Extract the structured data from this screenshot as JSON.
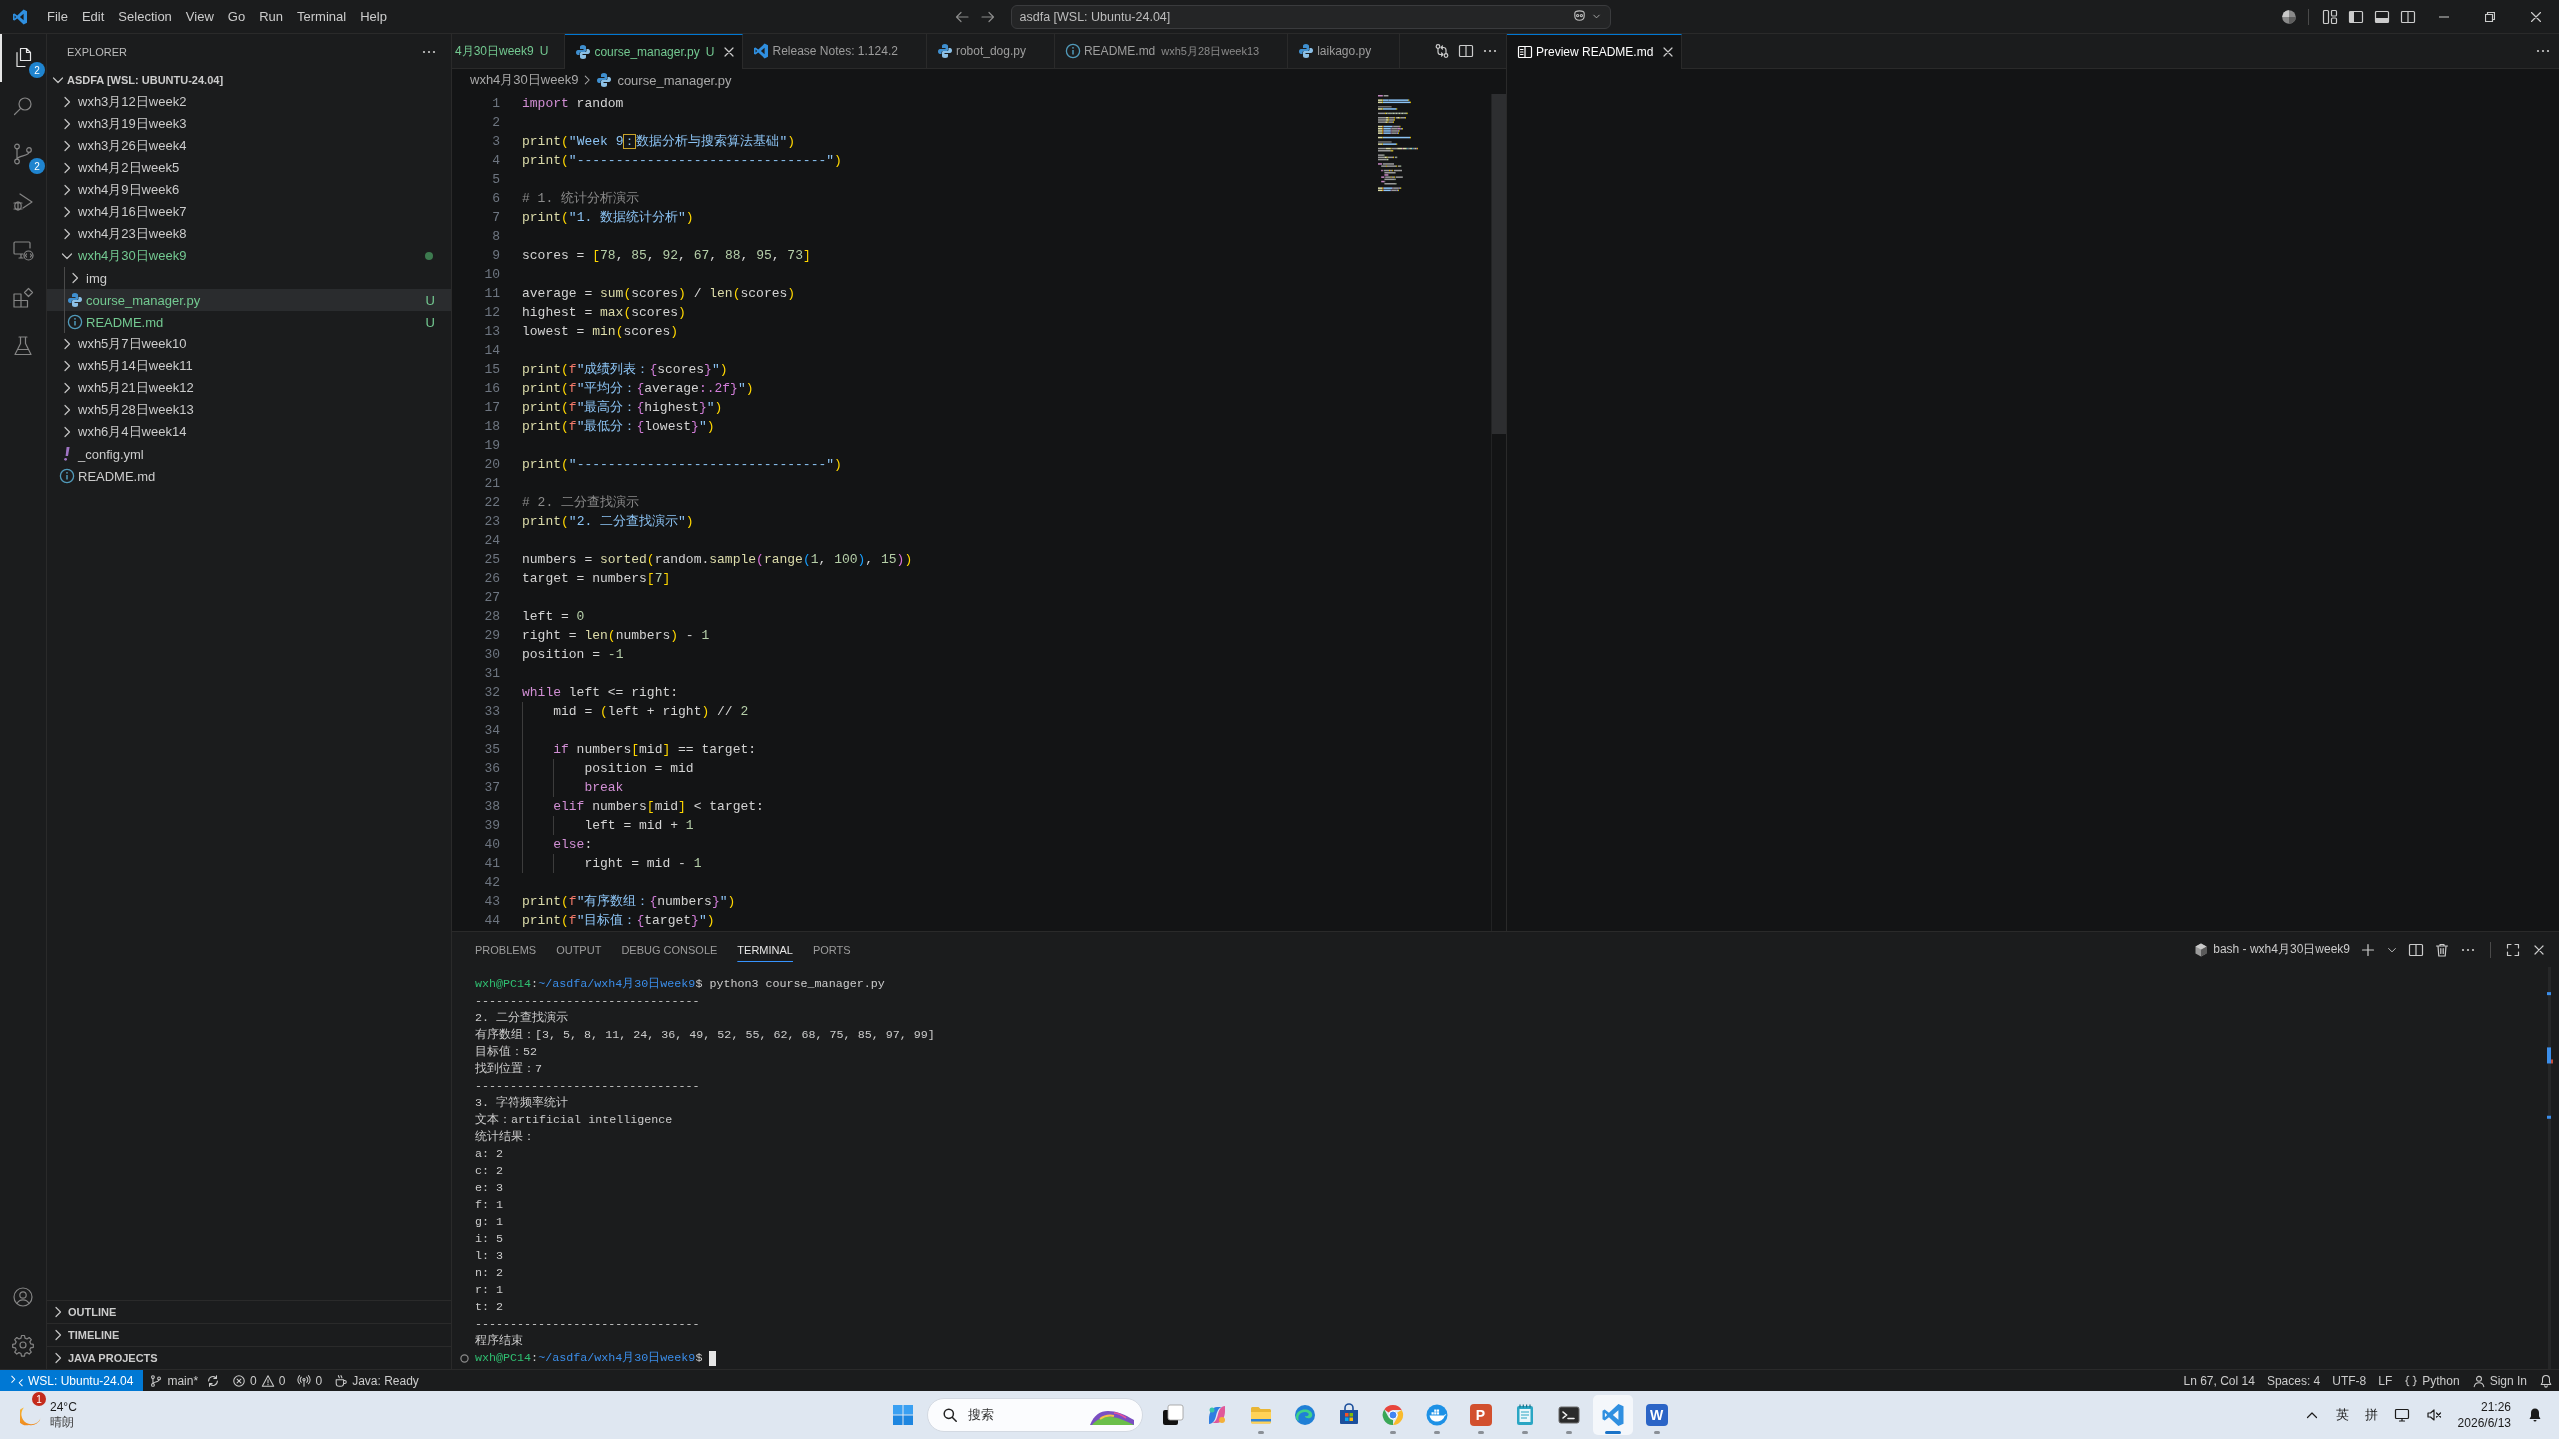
{
  "title_bar": {
    "menu": [
      "File",
      "Edit",
      "Selection",
      "View",
      "Go",
      "Run",
      "Terminal",
      "Help"
    ],
    "command_center": "asdfa [WSL: Ubuntu-24.04]"
  },
  "activity_bar": {
    "items": [
      {
        "kind": "explorer",
        "selected": true,
        "badge": "2"
      },
      {
        "kind": "search",
        "selected": false
      },
      {
        "kind": "source-control",
        "selected": false,
        "badge": "2"
      },
      {
        "kind": "run-debug",
        "selected": false
      },
      {
        "kind": "remote",
        "selected": false
      },
      {
        "kind": "extensions",
        "selected": false
      },
      {
        "kind": "testing",
        "selected": false
      }
    ]
  },
  "sidebar": {
    "title": "EXPLORER",
    "root": {
      "label": "ASDFA [WSL: UBUNTU-24.04]",
      "expanded": true
    },
    "tree": [
      {
        "name": "wxh3月12日week2",
        "kind": "folder",
        "expanded": false,
        "selected": false,
        "untracked": false
      },
      {
        "name": "wxh3月19日week3",
        "kind": "folder",
        "expanded": false,
        "selected": false,
        "untracked": false
      },
      {
        "name": "wxh3月26日week4",
        "kind": "folder",
        "expanded": false,
        "selected": false,
        "untracked": false
      },
      {
        "name": "wxh4月2日week5",
        "kind": "folder",
        "expanded": false,
        "selected": false,
        "untracked": false
      },
      {
        "name": "wxh4月9日week6",
        "kind": "folder",
        "expanded": false,
        "selected": false,
        "untracked": false
      },
      {
        "name": "wxh4月16日week7",
        "kind": "folder",
        "expanded": false,
        "selected": false,
        "untracked": false
      },
      {
        "name": "wxh4月23日week8",
        "kind": "folder",
        "expanded": false,
        "selected": false,
        "untracked": false
      },
      {
        "name": "wxh4月30日week9",
        "kind": "folder",
        "expanded": true,
        "selected": false,
        "untracked": true,
        "children": [
          {
            "name": "img",
            "kind": "folder",
            "expanded": false,
            "selected": false,
            "untracked": false
          },
          {
            "name": "course_manager.py",
            "kind": "python",
            "selected": true,
            "untracked": true,
            "status": "U"
          },
          {
            "name": "README.md",
            "kind": "markdown",
            "selected": false,
            "untracked": true,
            "status": "U"
          }
        ]
      },
      {
        "name": "wxh5月7日week10",
        "kind": "folder",
        "expanded": false,
        "selected": false,
        "untracked": false
      },
      {
        "name": "wxh5月14日week11",
        "kind": "folder",
        "expanded": false,
        "selected": false,
        "untracked": false
      },
      {
        "name": "wxh5月21日week12",
        "kind": "folder",
        "expanded": false,
        "selected": false,
        "untracked": false
      },
      {
        "name": "wxh5月28日week13",
        "kind": "folder",
        "expanded": false,
        "selected": false,
        "untracked": false
      },
      {
        "name": "wxh6月4日week14",
        "kind": "folder",
        "expanded": false,
        "selected": false,
        "untracked": false
      },
      {
        "name": "_config.yml",
        "kind": "yaml",
        "selected": false,
        "untracked": false
      },
      {
        "name": "README.md",
        "kind": "markdown",
        "selected": false,
        "untracked": false
      }
    ],
    "sections": [
      {
        "title": "OUTLINE",
        "expanded": false
      },
      {
        "title": "TIMELINE",
        "expanded": false
      },
      {
        "title": "JAVA PROJECTS",
        "expanded": false
      }
    ]
  },
  "editor": {
    "tabs": [
      {
        "label": "4月30日week9",
        "status": "U",
        "selected": false
      },
      {
        "label": "course_manager.py",
        "kind": "python",
        "status": "U",
        "selected": true
      },
      {
        "label": "Release Notes: 1.124.2",
        "kind": "release-notes",
        "selected": false
      },
      {
        "label": "robot_dog.py",
        "kind": "python",
        "selected": false
      },
      {
        "label": "README.md",
        "description": "wxh5月28日week13",
        "kind": "markdown",
        "selected": false
      },
      {
        "label": "laikago.py",
        "kind": "python",
        "selected": false
      }
    ],
    "breadcrumb": [
      {
        "text": "wxh4月30日week9",
        "kind": "folder"
      },
      {
        "text": "course_manager.py",
        "kind": "python"
      }
    ],
    "lines": [
      {
        "number": "1",
        "tokens": [
          {
            "text": "import",
            "kind": "keyword"
          },
          {
            "text": " random",
            "kind": "plain"
          }
        ]
      },
      {
        "number": "2"
      },
      {
        "number": "3",
        "tokens": [
          {
            "text": "print",
            "kind": "function"
          },
          {
            "text": "(",
            "kind": "bracket1"
          },
          {
            "text": "\"Week 9",
            "kind": "string"
          },
          {
            "text": "：",
            "kind": "flagged"
          },
          {
            "text": "数据分析与搜索算法基础\"",
            "kind": "string"
          },
          {
            "text": ")",
            "kind": "bracket1"
          }
        ]
      },
      {
        "number": "4",
        "tokens": [
          {
            "text": "print",
            "kind": "function"
          },
          {
            "text": "(",
            "kind": "bracket1"
          },
          {
            "text": "\"--------------------------------\"",
            "kind": "string"
          },
          {
            "text": ")",
            "kind": "bracket1"
          }
        ]
      },
      {
        "number": "5"
      },
      {
        "number": "6",
        "tokens": [
          {
            "text": "# 1. 统计分析演示",
            "kind": "comment"
          }
        ]
      },
      {
        "number": "7",
        "tokens": [
          {
            "text": "print",
            "kind": "function"
          },
          {
            "text": "(",
            "kind": "bracket1"
          },
          {
            "text": "\"1. 数据统计分析\"",
            "kind": "string"
          },
          {
            "text": ")",
            "kind": "bracket1"
          }
        ]
      },
      {
        "number": "8"
      },
      {
        "number": "9",
        "tokens": [
          {
            "text": "scores = ",
            "kind": "plain"
          },
          {
            "text": "[",
            "kind": "bracket1"
          },
          {
            "text": "78",
            "kind": "number"
          },
          {
            "text": ", ",
            "kind": "plain"
          },
          {
            "text": "85",
            "kind": "number"
          },
          {
            "text": ", ",
            "kind": "plain"
          },
          {
            "text": "92",
            "kind": "number"
          },
          {
            "text": ", ",
            "kind": "plain"
          },
          {
            "text": "67",
            "kind": "number"
          },
          {
            "text": ", ",
            "kind": "plain"
          },
          {
            "text": "88",
            "kind": "number"
          },
          {
            "text": ", ",
            "kind": "plain"
          },
          {
            "text": "95",
            "kind": "number"
          },
          {
            "text": ", ",
            "kind": "plain"
          },
          {
            "text": "73",
            "kind": "number"
          },
          {
            "text": "]",
            "kind": "bracket1"
          }
        ]
      },
      {
        "number": "10"
      },
      {
        "number": "11",
        "tokens": [
          {
            "text": "average = ",
            "kind": "plain"
          },
          {
            "text": "sum",
            "kind": "function"
          },
          {
            "text": "(",
            "kind": "bracket1"
          },
          {
            "text": "scores",
            "kind": "plain"
          },
          {
            "text": ")",
            "kind": "bracket1"
          },
          {
            "text": " / ",
            "kind": "plain"
          },
          {
            "text": "len",
            "kind": "function"
          },
          {
            "text": "(",
            "kind": "bracket1"
          },
          {
            "text": "scores",
            "kind": "plain"
          },
          {
            "text": ")",
            "kind": "bracket1"
          }
        ]
      },
      {
        "number": "12",
        "tokens": [
          {
            "text": "highest = ",
            "kind": "plain"
          },
          {
            "text": "max",
            "kind": "function"
          },
          {
            "text": "(",
            "kind": "bracket1"
          },
          {
            "text": "scores",
            "kind": "plain"
          },
          {
            "text": ")",
            "kind": "bracket1"
          }
        ]
      },
      {
        "number": "13",
        "tokens": [
          {
            "text": "lowest = ",
            "kind": "plain"
          },
          {
            "text": "min",
            "kind": "function"
          },
          {
            "text": "(",
            "kind": "bracket1"
          },
          {
            "text": "scores",
            "kind": "plain"
          },
          {
            "text": ")",
            "kind": "bracket1"
          }
        ]
      },
      {
        "number": "14"
      },
      {
        "number": "15",
        "tokens": [
          {
            "text": "print",
            "kind": "function"
          },
          {
            "text": "(",
            "kind": "bracket1"
          },
          {
            "text": "f",
            "kind": "prefix"
          },
          {
            "text": "\"成绩列表：",
            "kind": "string"
          },
          {
            "text": "{",
            "kind": "interp"
          },
          {
            "text": "scores",
            "kind": "plain"
          },
          {
            "text": "}",
            "kind": "interp"
          },
          {
            "text": "\"",
            "kind": "string"
          },
          {
            "text": ")",
            "kind": "bracket1"
          }
        ]
      },
      {
        "number": "16",
        "tokens": [
          {
            "text": "print",
            "kind": "function"
          },
          {
            "text": "(",
            "kind": "bracket1"
          },
          {
            "text": "f",
            "kind": "prefix"
          },
          {
            "text": "\"平均分：",
            "kind": "string"
          },
          {
            "text": "{",
            "kind": "interp"
          },
          {
            "text": "average",
            "kind": "plain"
          },
          {
            "text": ":.2f",
            "kind": "format"
          },
          {
            "text": "}",
            "kind": "interp"
          },
          {
            "text": "\"",
            "kind": "string"
          },
          {
            "text": ")",
            "kind": "bracket1"
          }
        ]
      },
      {
        "number": "17",
        "tokens": [
          {
            "text": "print",
            "kind": "function"
          },
          {
            "text": "(",
            "kind": "bracket1"
          },
          {
            "text": "f",
            "kind": "prefix"
          },
          {
            "text": "\"最高分：",
            "kind": "string"
          },
          {
            "text": "{",
            "kind": "interp"
          },
          {
            "text": "highest",
            "kind": "plain"
          },
          {
            "text": "}",
            "kind": "interp"
          },
          {
            "text": "\"",
            "kind": "string"
          },
          {
            "text": ")",
            "kind": "bracket1"
          }
        ]
      },
      {
        "number": "18",
        "tokens": [
          {
            "text": "print",
            "kind": "function"
          },
          {
            "text": "(",
            "kind": "bracket1"
          },
          {
            "text": "f",
            "kind": "prefix"
          },
          {
            "text": "\"最低分：",
            "kind": "string"
          },
          {
            "text": "{",
            "kind": "interp"
          },
          {
            "text": "lowest",
            "kind": "plain"
          },
          {
            "text": "}",
            "kind": "interp"
          },
          {
            "text": "\"",
            "kind": "string"
          },
          {
            "text": ")",
            "kind": "bracket1"
          }
        ]
      },
      {
        "number": "19"
      },
      {
        "number": "20",
        "tokens": [
          {
            "text": "print",
            "kind": "function"
          },
          {
            "text": "(",
            "kind": "bracket1"
          },
          {
            "text": "\"--------------------------------\"",
            "kind": "string"
          },
          {
            "text": ")",
            "kind": "bracket1"
          }
        ]
      },
      {
        "number": "21"
      },
      {
        "number": "22",
        "tokens": [
          {
            "text": "# 2. 二分查找演示",
            "kind": "comment"
          }
        ]
      },
      {
        "number": "23",
        "tokens": [
          {
            "text": "print",
            "kind": "function"
          },
          {
            "text": "(",
            "kind": "bracket1"
          },
          {
            "text": "\"2. 二分查找演示\"",
            "kind": "string"
          },
          {
            "text": ")",
            "kind": "bracket1"
          }
        ]
      },
      {
        "number": "24"
      },
      {
        "number": "25",
        "tokens": [
          {
            "text": "numbers = ",
            "kind": "plain"
          },
          {
            "text": "sorted",
            "kind": "function"
          },
          {
            "text": "(",
            "kind": "bracket1"
          },
          {
            "text": "random.",
            "kind": "plain"
          },
          {
            "text": "sample",
            "kind": "function"
          },
          {
            "text": "(",
            "kind": "bracket2"
          },
          {
            "text": "range",
            "kind": "function"
          },
          {
            "text": "(",
            "kind": "bracket3"
          },
          {
            "text": "1",
            "kind": "number"
          },
          {
            "text": ", ",
            "kind": "plain"
          },
          {
            "text": "100",
            "kind": "number"
          },
          {
            "text": ")",
            "kind": "bracket3"
          },
          {
            "text": ", ",
            "kind": "plain"
          },
          {
            "text": "15",
            "kind": "number"
          },
          {
            "text": ")",
            "kind": "bracket2"
          },
          {
            "text": ")",
            "kind": "bracket1"
          }
        ]
      },
      {
        "number": "26",
        "tokens": [
          {
            "text": "target = numbers",
            "kind": "plain"
          },
          {
            "text": "[",
            "kind": "bracket1"
          },
          {
            "text": "7",
            "kind": "number"
          },
          {
            "text": "]",
            "kind": "bracket1"
          }
        ]
      },
      {
        "number": "27"
      },
      {
        "number": "28",
        "tokens": [
          {
            "text": "left = ",
            "kind": "plain"
          },
          {
            "text": "0",
            "kind": "number"
          }
        ]
      },
      {
        "number": "29",
        "tokens": [
          {
            "text": "right = ",
            "kind": "plain"
          },
          {
            "text": "len",
            "kind": "function"
          },
          {
            "text": "(",
            "kind": "bracket1"
          },
          {
            "text": "numbers",
            "kind": "plain"
          },
          {
            "text": ")",
            "kind": "bracket1"
          },
          {
            "text": " - ",
            "kind": "plain"
          },
          {
            "text": "1",
            "kind": "number"
          }
        ]
      },
      {
        "number": "30",
        "tokens": [
          {
            "text": "position = ",
            "kind": "plain"
          },
          {
            "text": "-1",
            "kind": "number"
          }
        ]
      },
      {
        "number": "31"
      },
      {
        "number": "32",
        "tokens": [
          {
            "text": "while",
            "kind": "keyword"
          },
          {
            "text": " left <= right:",
            "kind": "plain"
          }
        ]
      },
      {
        "number": "33",
        "tokens": [
          {
            "text": "    mid = ",
            "kind": "plain"
          },
          {
            "text": "(",
            "kind": "bracket1"
          },
          {
            "text": "left + right",
            "kind": "plain"
          },
          {
            "text": ")",
            "kind": "bracket1"
          },
          {
            "text": " // ",
            "kind": "plain"
          },
          {
            "text": "2",
            "kind": "number"
          }
        ]
      },
      {
        "number": "34"
      },
      {
        "number": "35",
        "tokens": [
          {
            "text": "    if",
            "kind": "keyword"
          },
          {
            "text": " numbers",
            "kind": "plain"
          },
          {
            "text": "[",
            "kind": "bracket1"
          },
          {
            "text": "mid",
            "kind": "plain"
          },
          {
            "text": "]",
            "kind": "bracket1"
          },
          {
            "text": " == target:",
            "kind": "plain"
          }
        ]
      },
      {
        "number": "36",
        "tokens": [
          {
            "text": "        position = mid",
            "kind": "plain"
          }
        ]
      },
      {
        "number": "37",
        "tokens": [
          {
            "text": "        break",
            "kind": "keyword"
          }
        ]
      },
      {
        "number": "38",
        "tokens": [
          {
            "text": "    elif",
            "kind": "keyword"
          },
          {
            "text": " numbers",
            "kind": "plain"
          },
          {
            "text": "[",
            "kind": "bracket1"
          },
          {
            "text": "mid",
            "kind": "plain"
          },
          {
            "text": "]",
            "kind": "bracket1"
          },
          {
            "text": " < target:",
            "kind": "plain"
          }
        ]
      },
      {
        "number": "39",
        "tokens": [
          {
            "text": "        left = mid + ",
            "kind": "plain"
          },
          {
            "text": "1",
            "kind": "number"
          }
        ]
      },
      {
        "number": "40",
        "tokens": [
          {
            "text": "    else",
            "kind": "keyword"
          },
          {
            "text": ":",
            "kind": "plain"
          }
        ]
      },
      {
        "number": "41",
        "tokens": [
          {
            "text": "        right = mid - ",
            "kind": "plain"
          },
          {
            "text": "1",
            "kind": "number"
          }
        ]
      },
      {
        "number": "42"
      },
      {
        "number": "43",
        "tokens": [
          {
            "text": "print",
            "kind": "function"
          },
          {
            "text": "(",
            "kind": "bracket1"
          },
          {
            "text": "f",
            "kind": "prefix"
          },
          {
            "text": "\"有序数组：",
            "kind": "string"
          },
          {
            "text": "{",
            "kind": "interp"
          },
          {
            "text": "numbers",
            "kind": "plain"
          },
          {
            "text": "}",
            "kind": "interp"
          },
          {
            "text": "\"",
            "kind": "string"
          },
          {
            "text": ")",
            "kind": "bracket1"
          }
        ]
      },
      {
        "number": "44",
        "tokens": [
          {
            "text": "print",
            "kind": "function"
          },
          {
            "text": "(",
            "kind": "bracket1"
          },
          {
            "text": "f",
            "kind": "prefix"
          },
          {
            "text": "\"目标值：",
            "kind": "string"
          },
          {
            "text": "{",
            "kind": "interp"
          },
          {
            "text": "target",
            "kind": "plain"
          },
          {
            "text": "}",
            "kind": "interp"
          },
          {
            "text": "\"",
            "kind": "string"
          },
          {
            "text": ")",
            "kind": "bracket1"
          }
        ]
      }
    ]
  },
  "preview": {
    "tabs": [
      {
        "label": "Preview README.md",
        "kind": "preview",
        "selected": true
      }
    ]
  },
  "panel": {
    "tabs": [
      {
        "label": "PROBLEMS",
        "selected": false
      },
      {
        "label": "OUTPUT",
        "selected": false
      },
      {
        "label": "DEBUG CONSOLE",
        "selected": false
      },
      {
        "label": "TERMINAL",
        "selected": true
      },
      {
        "label": "PORTS",
        "selected": false
      }
    ],
    "terminal_name": "bash - wxh4月30日week9",
    "lines": [
      {
        "kind": "prompt",
        "user": "wxh@PC14",
        "separator": ":",
        "path": "~/asdfa/wxh4月30日week9",
        "symbol": "$",
        "command": "python3 course_manager.py",
        "marker": false,
        "cursor": false
      },
      {
        "kind": "output",
        "text": "--------------------------------"
      },
      {
        "kind": "output",
        "text": "2. 二分查找演示"
      },
      {
        "kind": "output",
        "text": "有序数组：[3, 5, 8, 11, 24, 36, 49, 52, 55, 62, 68, 75, 85, 97, 99]"
      },
      {
        "kind": "output",
        "text": "目标值：52"
      },
      {
        "kind": "output",
        "text": "找到位置：7"
      },
      {
        "kind": "output",
        "text": "--------------------------------"
      },
      {
        "kind": "output",
        "text": "3. 字符频率统计"
      },
      {
        "kind": "output",
        "text": "文本：artificial intelligence"
      },
      {
        "kind": "output",
        "text": "统计结果："
      },
      {
        "kind": "output",
        "text": "a: 2"
      },
      {
        "kind": "output",
        "text": "c: 2"
      },
      {
        "kind": "output",
        "text": "e: 3"
      },
      {
        "kind": "output",
        "text": "f: 1"
      },
      {
        "kind": "output",
        "text": "g: 1"
      },
      {
        "kind": "output",
        "text": "i: 5"
      },
      {
        "kind": "output",
        "text": "l: 3"
      },
      {
        "kind": "output",
        "text": "n: 2"
      },
      {
        "kind": "output",
        "text": "r: 1"
      },
      {
        "kind": "output",
        "text": "t: 2"
      },
      {
        "kind": "output",
        "text": "--------------------------------"
      },
      {
        "kind": "output",
        "text": "程序结束"
      },
      {
        "kind": "prompt",
        "user": "wxh@PC14",
        "separator": ":",
        "path": "~/asdfa/wxh4月30日week9",
        "symbol": "$",
        "marker": true,
        "cursor": true
      }
    ]
  },
  "status_bar": {
    "left": [
      {
        "kind": "remote",
        "text": "WSL: Ubuntu-24.04"
      },
      {
        "kind": "branch",
        "text": "main*"
      },
      {
        "kind": "problems",
        "errors": "0",
        "warnings": "0"
      },
      {
        "kind": "ports",
        "text": "0"
      },
      {
        "kind": "java",
        "text": "Java: Ready"
      }
    ],
    "right": [
      {
        "kind": "text",
        "text": "Ln 67, Col 14"
      },
      {
        "kind": "text",
        "text": "Spaces: 4"
      },
      {
        "kind": "text",
        "text": "UTF-8"
      },
      {
        "kind": "text",
        "text": "LF"
      },
      {
        "kind": "language",
        "text": "Python"
      },
      {
        "kind": "account",
        "text": "Sign In"
      }
    ]
  },
  "taskbar": {
    "weather": {
      "temperature": "24°C",
      "condition": "晴朗",
      "badge": "1"
    },
    "search": {
      "placeholder": "搜索"
    },
    "apps": [
      {
        "kind": "task-view",
        "selected": false,
        "running": false
      },
      {
        "kind": "assistant",
        "selected": false,
        "running": false
      },
      {
        "kind": "files",
        "selected": false,
        "running": true
      },
      {
        "kind": "browser-wave",
        "selected": false,
        "running": false
      },
      {
        "kind": "store",
        "selected": false,
        "running": false
      },
      {
        "kind": "browser-circle",
        "selected": false,
        "running": true
      },
      {
        "kind": "whale",
        "selected": false,
        "running": true
      },
      {
        "kind": "slides",
        "glyph": "P",
        "selected": false,
        "running": true
      },
      {
        "kind": "notepad",
        "selected": false,
        "running": true
      },
      {
        "kind": "terminal",
        "selected": false,
        "running": true
      },
      {
        "kind": "editor",
        "selected": true,
        "running": true
      },
      {
        "kind": "document",
        "glyph": "W",
        "selected": false,
        "running": true
      }
    ],
    "tray": {
      "language": "英",
      "ime": "拼",
      "time": "21:26",
      "date": "2026/6/13"
    }
  }
}
